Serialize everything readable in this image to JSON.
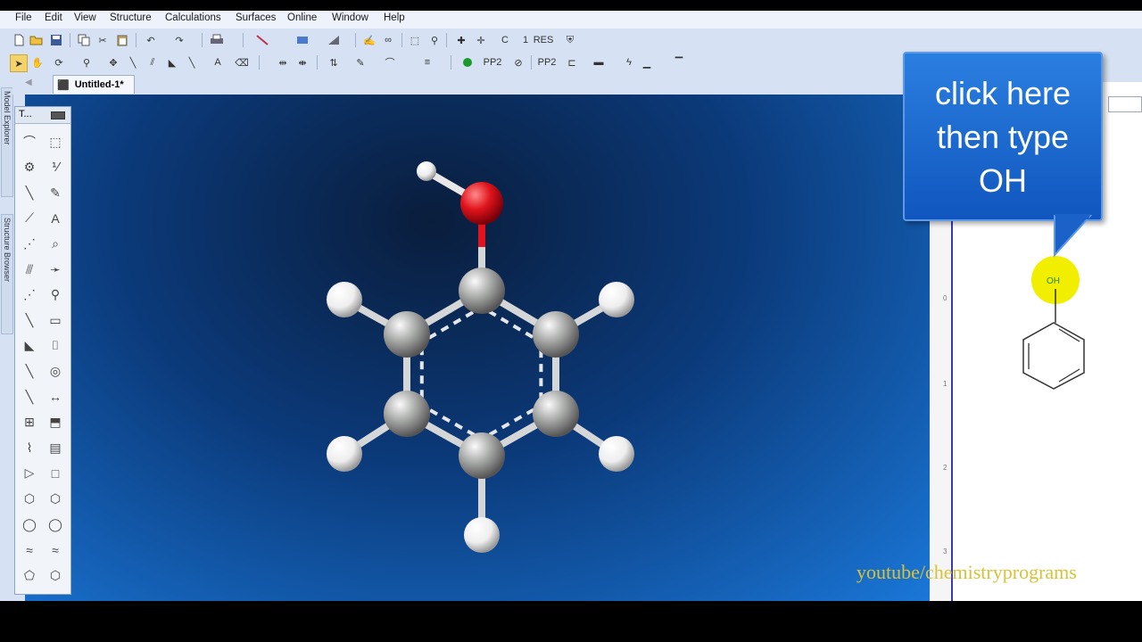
{
  "menu": [
    "File",
    "Edit",
    "View",
    "Structure",
    "Calculations",
    "Surfaces",
    "Online",
    "Window",
    "Help"
  ],
  "document_tab": "Untitled-1*",
  "left_dock": [
    "Model Explorer",
    "Structure Browser"
  ],
  "palette_header": "T...",
  "toolbar_text": {
    "c": "C",
    "one": "1",
    "res": "RES",
    "pp2": "PP2",
    "a": "A"
  },
  "molecule_2d_label": "OH",
  "ruler_marks": [
    "0",
    "1",
    "2",
    "3"
  ],
  "callout": {
    "lines": [
      "click here",
      "then type",
      "OH"
    ]
  },
  "watermark": "youtube/chemistryprograms",
  "colors": {
    "oxygen": "#e0141c",
    "carbon": "#a8aaa8",
    "hydrogen": "#f2f2f2",
    "highlight": "#f2ee00",
    "accent": "#1a66cc"
  }
}
